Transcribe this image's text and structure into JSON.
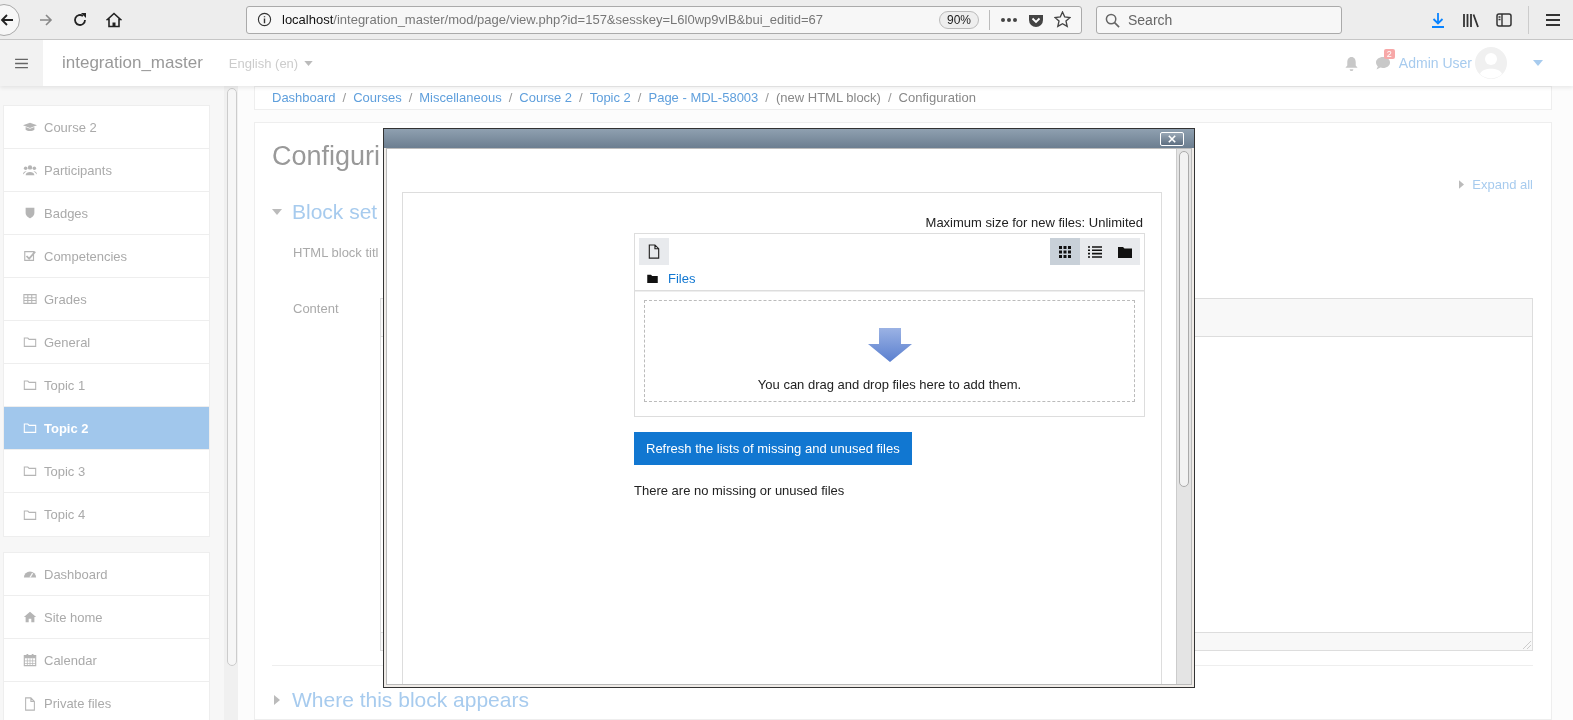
{
  "browser": {
    "url_host": "localhost",
    "url_path": "/integration_master/mod/page/view.php?id=157&sesskey=L6l0wp9vlB&bui_editid=67",
    "zoom": "90%",
    "search": {
      "placeholder": "Search"
    }
  },
  "navbar": {
    "site_name": "integration_master",
    "language": "English (en)",
    "message_count": "2",
    "user_name": "Admin User"
  },
  "breadcrumb": [
    {
      "label": "Dashboard",
      "separator": "/"
    },
    {
      "label": "Courses",
      "separator": "/"
    },
    {
      "label": "Miscellaneous",
      "separator": "/"
    },
    {
      "label": "Course 2",
      "separator": "/"
    },
    {
      "label": "Topic 2",
      "separator": "/"
    },
    {
      "label": "Page - MDL-58003",
      "separator": "/"
    },
    {
      "label": "(new HTML block)",
      "separator": "/"
    },
    {
      "label": "Configuration"
    }
  ],
  "sidebar": {
    "groups": [
      [
        {
          "label": "Course 2",
          "kind": "cap",
          "selected": false
        },
        {
          "label": "Participants",
          "kind": "users",
          "selected": false
        },
        {
          "label": "Badges",
          "kind": "shield",
          "selected": false
        },
        {
          "label": "Competencies",
          "kind": "check",
          "selected": false
        },
        {
          "label": "Grades",
          "kind": "table",
          "selected": false
        },
        {
          "label": "General",
          "kind": "folder",
          "selected": false
        },
        {
          "label": "Topic 1",
          "kind": "folder",
          "selected": false
        },
        {
          "label": "Topic 2",
          "kind": "folder",
          "selected": true
        },
        {
          "label": "Topic 3",
          "kind": "folder",
          "selected": false
        },
        {
          "label": "Topic 4",
          "kind": "folder",
          "selected": false
        }
      ],
      [
        {
          "label": "Dashboard",
          "kind": "gauge",
          "selected": false
        },
        {
          "label": "Site home",
          "kind": "home",
          "selected": false
        },
        {
          "label": "Calendar",
          "kind": "calendar",
          "selected": false
        },
        {
          "label": "Private files",
          "kind": "file",
          "selected": false
        }
      ]
    ]
  },
  "page": {
    "heading": "Configuri",
    "expand_all": "Expand all",
    "sections": [
      {
        "title": "Block set",
        "expanded": true
      },
      {
        "title": "Where this block appears",
        "expanded": false
      }
    ],
    "field_labels": [
      "HTML block titl",
      "Content"
    ]
  },
  "dialog": {
    "max_size": "Maximum size for new files: Unlimited",
    "path": "Files",
    "views": [
      {
        "kind": "grid",
        "selected": true
      },
      {
        "kind": "list",
        "selected": false
      },
      {
        "kind": "tree",
        "selected": false
      }
    ],
    "drop_hint": "You can drag and drop files here to add them.",
    "refresh_button": "Refresh the lists of missing and unused files",
    "status": "There are no missing or unused files"
  }
}
